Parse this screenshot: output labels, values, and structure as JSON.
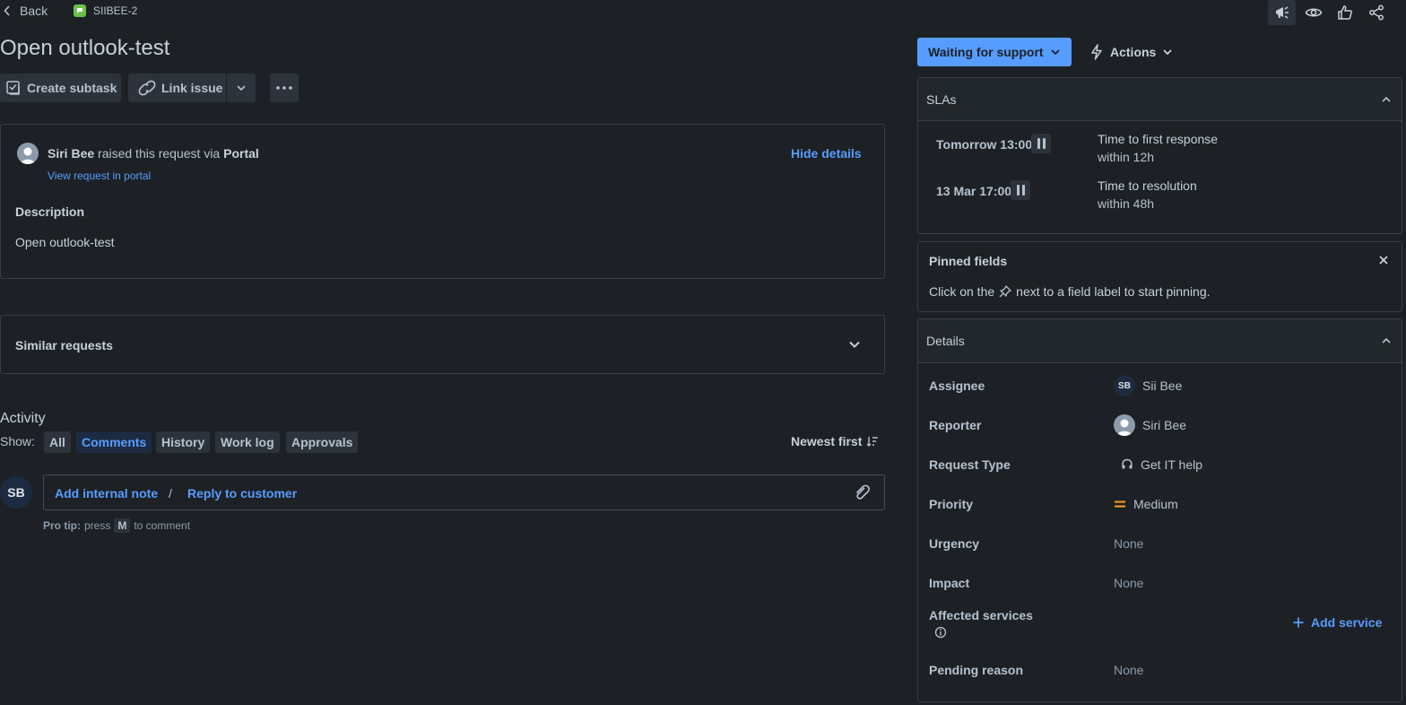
{
  "topbar": {
    "back_label": "Back",
    "issue_key": "SIIBEE-2",
    "icons": [
      "megaphone-icon",
      "watch-icon",
      "thumbs-up-icon",
      "share-icon"
    ]
  },
  "issue": {
    "title": "Open outlook-test"
  },
  "toolbar": {
    "create_subtask": "Create subtask",
    "link_issue": "Link issue"
  },
  "request": {
    "reporter": "Siri Bee",
    "raised_text": " raised this request via ",
    "channel": "Portal",
    "view_portal": "View request in portal",
    "hide_details": "Hide details",
    "description_label": "Description",
    "description": "Open outlook-test"
  },
  "similar": {
    "title": "Similar requests"
  },
  "activity": {
    "title": "Activity",
    "show_label": "Show:",
    "filters": [
      "All",
      "Comments",
      "History",
      "Work log",
      "Approvals"
    ],
    "selected": "Comments",
    "sort": "Newest first",
    "avatar": "SB",
    "add_internal_note": "Add internal note",
    "separator": "/",
    "reply_to_customer": "Reply to customer",
    "protip_bold": "Pro tip:",
    "protip_press": "press",
    "protip_key": "M",
    "protip_tail": "to comment"
  },
  "status": {
    "label": "Waiting for support",
    "actions": "Actions"
  },
  "slas": {
    "title": "SLAs",
    "items": [
      {
        "time": "Tomorrow 13:00",
        "name": "Time to first response",
        "goal": "within 12h"
      },
      {
        "time": "13 Mar 17:00",
        "name": "Time to resolution",
        "goal": "within 48h"
      }
    ]
  },
  "pinned": {
    "title": "Pinned fields",
    "text_before": "Click on the",
    "text_after": "next to a field label to start pinning."
  },
  "details": {
    "title": "Details",
    "assignee_label": "Assignee",
    "assignee_initials": "SB",
    "assignee": "Sii Bee",
    "reporter_label": "Reporter",
    "reporter": "Siri Bee",
    "request_type_label": "Request Type",
    "request_type": "Get IT help",
    "priority_label": "Priority",
    "priority": "Medium",
    "urgency_label": "Urgency",
    "urgency": "None",
    "impact_label": "Impact",
    "impact": "None",
    "affected_label": "Affected services",
    "add_service": "Add service",
    "pending_label": "Pending reason",
    "pending": "None"
  },
  "colors": {
    "background": "#1d2125",
    "accent": "#579dff",
    "priority_medium": "#f5a623"
  }
}
